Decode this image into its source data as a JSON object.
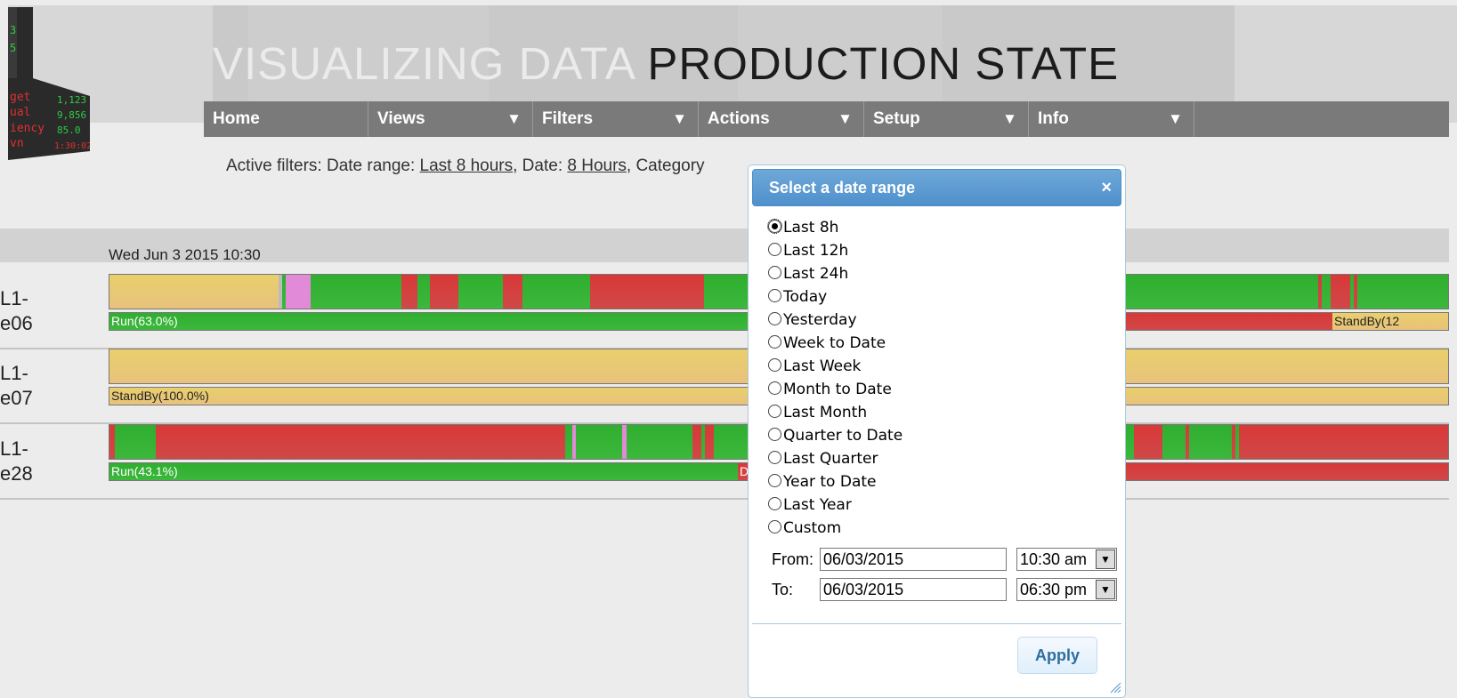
{
  "header": {
    "title_light": "VISUALIZING DATA ",
    "title_dark": "PRODUCTION STATE",
    "logo_lines": [
      {
        "label": "get",
        "value": "1,123"
      },
      {
        "label": "ual",
        "value": "9,856"
      },
      {
        "label": "iency",
        "value": "85.0"
      },
      {
        "label": "vn",
        "value": "1:30:02"
      }
    ]
  },
  "menu": [
    {
      "label": "Home",
      "has_arrow": false
    },
    {
      "label": "Views",
      "arrow": "▼"
    },
    {
      "label": "Filters",
      "arrow": "▼"
    },
    {
      "label": "Actions",
      "arrow": "▼"
    },
    {
      "label": "Setup",
      "arrow": "▼"
    },
    {
      "label": "Info",
      "arrow": "▼"
    }
  ],
  "filters": {
    "prefix": "Active filters: Date range: ",
    "date_range_link": "Last 8 hours",
    "date_sep": ", Date: ",
    "date_link": "8 Hours",
    "category_sep": ", Category"
  },
  "timeline": {
    "start_label": "Wed Jun 3 2015 10:30",
    "rows": [
      {
        "machine_line1": "L1-",
        "machine_line2": "e06",
        "label_left": "Run(63.0%)",
        "label_right": "StandBy(12"
      },
      {
        "machine_line1": "L1-",
        "machine_line2": "e07",
        "label_left": "StandBy(100.0%)"
      },
      {
        "machine_line1": "L1-",
        "machine_line2": "e28",
        "label_left": "Run(43.1%)",
        "label_mid": "D"
      }
    ]
  },
  "dialog": {
    "title": "Select a date range",
    "close": "×",
    "options": [
      "Last 8h",
      "Last 12h",
      "Last 24h",
      "Today",
      "Yesterday",
      "Week to Date",
      "Last Week",
      "Month to Date",
      "Last Month",
      "Quarter to Date",
      "Last Quarter",
      "Year to Date",
      "Last Year",
      "Custom"
    ],
    "selected": "Last 8h",
    "from_label": "From:",
    "from_date": "06/03/2015",
    "from_time": "10:30 am",
    "to_label": "To:",
    "to_date": "06/03/2015",
    "to_time": "06:30 pm",
    "apply_label": "Apply"
  },
  "colors": {
    "run": "#35b135",
    "standby": "#e8c874",
    "down": "#d63c3c",
    "setup": "#e08ad8",
    "menu_bg": "#7a7a7a",
    "dialog_title": "#5b9bd5"
  }
}
